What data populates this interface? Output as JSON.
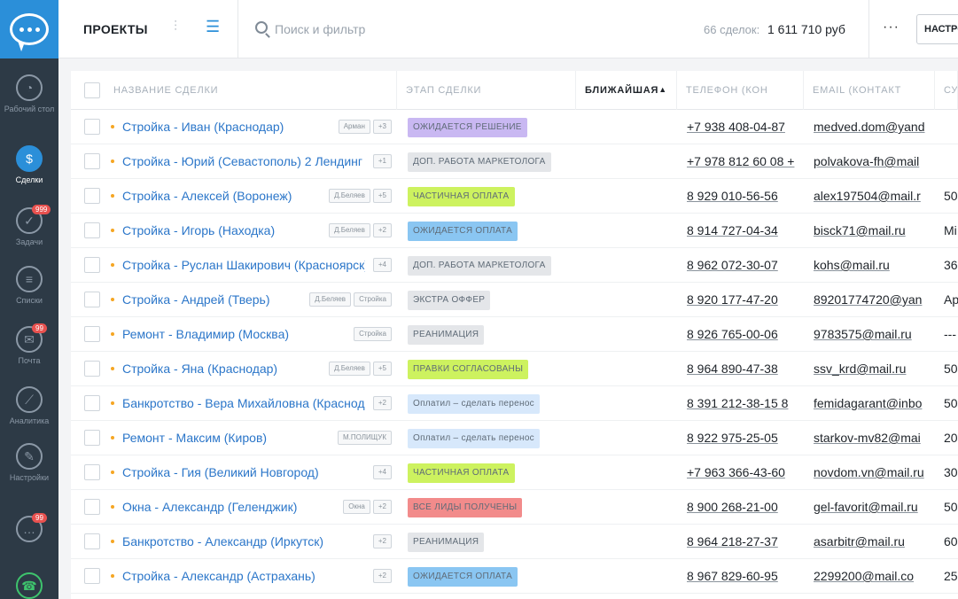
{
  "sidebar": {
    "items": [
      {
        "label": "Рабочий стол",
        "icon": "gauge-icon",
        "active": false
      },
      {
        "label": "Сделки",
        "icon": "dollar-icon",
        "active": true
      },
      {
        "label": "Задачи",
        "icon": "check-icon",
        "badge": "999",
        "active": false
      },
      {
        "label": "Списки",
        "icon": "database-icon",
        "active": false
      },
      {
        "label": "Почта",
        "icon": "mail-icon",
        "badge": "99",
        "active": false
      },
      {
        "label": "Аналитика",
        "icon": "chart-icon",
        "active": false
      },
      {
        "label": "Настройки",
        "icon": "wrench-icon",
        "active": false
      }
    ],
    "chat_badge": "99"
  },
  "header": {
    "title": "ПРОЕКТЫ",
    "search_placeholder": "Поиск и фильтр",
    "deals_count": "66 сделок:",
    "deals_sum": "1 611 710 руб",
    "more": "···",
    "settings": "НАСТРОЙКИ"
  },
  "columns": {
    "name": "НАЗВАНИЕ СДЕЛКИ",
    "stage": "ЭТАП СДЕЛКИ",
    "nearest": "БЛИЖАЙШАЯ",
    "phone": "ТЕЛЕФОН (КОН",
    "email": "EMAIL (КОНТАКТ",
    "extra": "СУ"
  },
  "rows": [
    {
      "name": "Стройка - Иван (Краснодар)",
      "tags": [
        "Арман",
        "+3"
      ],
      "stage": "ОЖИДАЕТСЯ РЕШЕНИЕ",
      "stage_color": "#c9b8f2",
      "phone": "+7 938 408-04-87",
      "email": "medved.dom@yand",
      "extra": ""
    },
    {
      "name": "Стройка - Юрий (Севастополь) 2 Лендинг",
      "tags": [
        "+1"
      ],
      "stage": "ДОП. РАБОТА МАРКЕТОЛОГА",
      "stage_color": "#e4e6e9",
      "phone": "+7 978 812 60 08 +",
      "email": "polvakova-fh@mail",
      "extra": ""
    },
    {
      "name": "Стройка - Алексей (Воронеж)",
      "tags": [
        "Д.Беляев",
        "+5"
      ],
      "stage": "ЧАСТИЧНАЯ ОПЛАТА",
      "stage_color": "#cdf25f",
      "phone": "8 929 010-56-56",
      "email": "alex197504@mail.r",
      "extra": "50"
    },
    {
      "name": "Стройка - Игорь (Находка)",
      "tags": [
        "Д.Беляев",
        "+2"
      ],
      "stage": "ОЖИДАЕТСЯ ОПЛАТА",
      "stage_color": "#8ac6f2",
      "phone": "8 914 727-04-34",
      "email": "bisck71@mail.ru",
      "extra": "Mi"
    },
    {
      "name": "Стройка - Руслан Шакирович (Красноярск)",
      "tags": [
        "+4"
      ],
      "stage": "ДОП. РАБОТА МАРКЕТОЛОГА",
      "stage_color": "#e4e6e9",
      "phone": "8 962 072-30-07",
      "email": "kohs@mail.ru",
      "extra": "36"
    },
    {
      "name": "Стройка - Андрей (Тверь)",
      "tags": [
        "Д.Беляев",
        "Стройка"
      ],
      "stage": "ЭКСТРА ОФФЕР",
      "stage_color": "#e4e6e9",
      "phone": "8 920 177-47-20",
      "email": "89201774720@yan",
      "extra": "Ap"
    },
    {
      "name": "Ремонт - Владимир (Москва)",
      "tags": [
        "Стройка"
      ],
      "stage": "РЕАНИМАЦИЯ",
      "stage_color": "#e4e6e9",
      "phone": "8 926 765-00-06",
      "email": "9783575@mail.ru",
      "extra": "---"
    },
    {
      "name": "Стройка - Яна (Краснодар)",
      "tags": [
        "Д.Беляев",
        "+5"
      ],
      "stage": "ПРАВКИ СОГЛАСОВАНЫ",
      "stage_color": "#cdf25f",
      "phone": "8 964 890-47-38",
      "email": "ssv_krd@mail.ru",
      "extra": "50"
    },
    {
      "name": "Банкротство - Вера Михайловна (Краснодар)",
      "tags": [
        "+2"
      ],
      "stage": "Оплатил – сделать перенос",
      "stage_color": "#d7e8fb",
      "phone": "8 391 212-38-15 8",
      "email": "femidagarant@inbo",
      "extra": "50"
    },
    {
      "name": "Ремонт - Максим (Киров)",
      "tags": [
        "М.ПОЛИЩУК"
      ],
      "stage": "Оплатил – сделать перенос",
      "stage_color": "#d7e8fb",
      "phone": "8 922 975-25-05",
      "email": "starkov-mv82@mai",
      "extra": "20"
    },
    {
      "name": "Стройка - Гия (Великий Новгород)",
      "tags": [
        "+4"
      ],
      "stage": "ЧАСТИЧНАЯ ОПЛАТА",
      "stage_color": "#cdf25f",
      "phone": "+7 963 366-43-60",
      "email": "novdom.vn@mail.ru",
      "extra": "30"
    },
    {
      "name": "Окна - Александр (Геленджик)",
      "tags": [
        "Окна",
        "+2"
      ],
      "stage": "ВСЕ ЛИДЫ ПОЛУЧЕНЫ",
      "stage_color": "#f28b8b",
      "phone": "8 900 268-21-00",
      "email": "gel-favorit@mail.ru",
      "extra": "50"
    },
    {
      "name": "Банкротство - Александр (Иркутск)",
      "tags": [
        "+2"
      ],
      "stage": "РЕАНИМАЦИЯ",
      "stage_color": "#e4e6e9",
      "phone": "8 964 218-27-37",
      "email": "asarbitr@mail.ru",
      "extra": "60"
    },
    {
      "name": "Стройка - Александр (Астрахань)",
      "tags": [
        "+2"
      ],
      "stage": "ОЖИДАЕТСЯ ОПЛАТА",
      "stage_color": "#8ac6f2",
      "phone": "8 967 829-60-95",
      "email": "2299200@mail.co",
      "extra": "25"
    }
  ]
}
